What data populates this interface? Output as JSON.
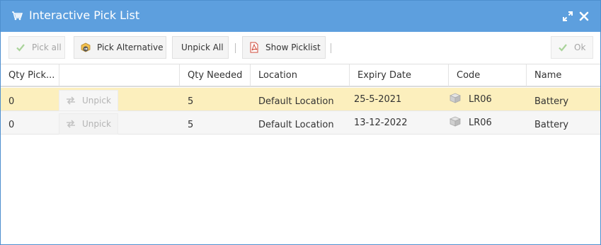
{
  "window": {
    "title": "Interactive Pick List",
    "title_color": "#5d9fde"
  },
  "toolbar": {
    "pick_all": "Pick all",
    "pick_alternative": "Pick Alternative",
    "unpick_all": "Unpick All",
    "show_picklist": "Show Picklist",
    "ok": "Ok"
  },
  "table": {
    "columns": [
      "Qty Pick...",
      "",
      "Qty Needed",
      "Location",
      "Expiry Date",
      "Code",
      "Name"
    ],
    "unpick_label": "Unpick",
    "rows": [
      {
        "qty_picked": "0",
        "qty_needed": "5",
        "location": "Default Location",
        "expiry": "25-5-2021",
        "code": "LR06",
        "name": "Battery",
        "selected": true
      },
      {
        "qty_picked": "0",
        "qty_needed": "5",
        "location": "Default Location",
        "expiry": "13-12-2022",
        "code": "LR06",
        "name": "Battery",
        "selected": false
      }
    ]
  },
  "colors": {
    "selected_row": "#fcefbd",
    "accent": "#5d9fde"
  }
}
